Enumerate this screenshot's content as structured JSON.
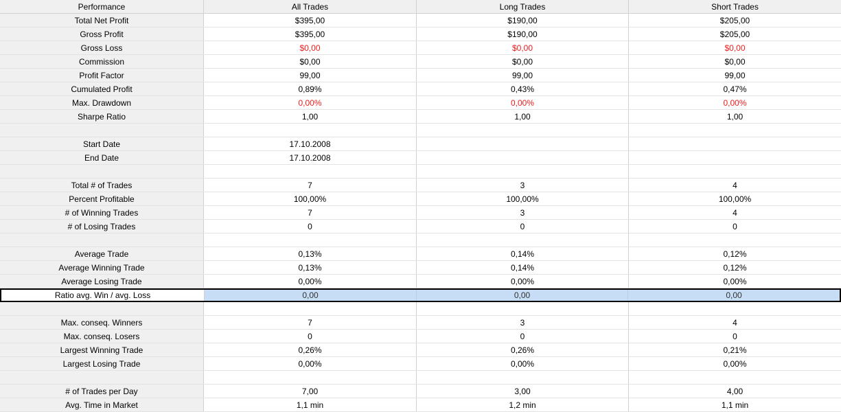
{
  "colors": {
    "negative_text": "#ee1c1c",
    "selected_row_bg": "#c6ddf5",
    "label_column_bg": "#f0f0f0"
  },
  "header": [
    "Performance",
    "All Trades",
    "Long Trades",
    "Short Trades"
  ],
  "rows": [
    {
      "label": "Total Net Profit",
      "values": [
        "$395,00",
        "$190,00",
        "$205,00"
      ]
    },
    {
      "label": "Gross Profit",
      "values": [
        "$395,00",
        "$190,00",
        "$205,00"
      ]
    },
    {
      "label": "Gross Loss",
      "values": [
        "$0,00",
        "$0,00",
        "$0,00"
      ],
      "negative": true
    },
    {
      "label": "Commission",
      "values": [
        "$0,00",
        "$0,00",
        "$0,00"
      ]
    },
    {
      "label": "Profit Factor",
      "values": [
        "99,00",
        "99,00",
        "99,00"
      ]
    },
    {
      "label": "Cumulated Profit",
      "values": [
        "0,89%",
        "0,43%",
        "0,47%"
      ]
    },
    {
      "label": "Max. Drawdown",
      "values": [
        "0,00%",
        "0,00%",
        "0,00%"
      ],
      "negative": true
    },
    {
      "label": "Sharpe Ratio",
      "values": [
        "1,00",
        "1,00",
        "1,00"
      ]
    },
    {
      "blank": true
    },
    {
      "label": "Start Date",
      "values": [
        "17.10.2008",
        "",
        ""
      ]
    },
    {
      "label": "End Date",
      "values": [
        "17.10.2008",
        "",
        ""
      ]
    },
    {
      "blank": true
    },
    {
      "label": "Total # of Trades",
      "values": [
        "7",
        "3",
        "4"
      ]
    },
    {
      "label": "Percent Profitable",
      "values": [
        "100,00%",
        "100,00%",
        "100,00%"
      ]
    },
    {
      "label": "# of Winning Trades",
      "values": [
        "7",
        "3",
        "4"
      ]
    },
    {
      "label": "# of Losing Trades",
      "values": [
        "0",
        "0",
        "0"
      ]
    },
    {
      "blank": true
    },
    {
      "label": "Average Trade",
      "values": [
        "0,13%",
        "0,14%",
        "0,12%"
      ]
    },
    {
      "label": "Average Winning Trade",
      "values": [
        "0,13%",
        "0,14%",
        "0,12%"
      ]
    },
    {
      "label": "Average Losing Trade",
      "values": [
        "0,00%",
        "0,00%",
        "0,00%"
      ]
    },
    {
      "label": "Ratio avg. Win / avg. Loss",
      "values": [
        "0,00",
        "0,00",
        "0,00"
      ],
      "selected": true
    },
    {
      "blank": true
    },
    {
      "label": "Max. conseq. Winners",
      "values": [
        "7",
        "3",
        "4"
      ]
    },
    {
      "label": "Max. conseq. Losers",
      "values": [
        "0",
        "0",
        "0"
      ]
    },
    {
      "label": "Largest Winning Trade",
      "values": [
        "0,26%",
        "0,26%",
        "0,21%"
      ]
    },
    {
      "label": "Largest Losing Trade",
      "values": [
        "0,00%",
        "0,00%",
        "0,00%"
      ]
    },
    {
      "blank": true
    },
    {
      "label": "# of Trades per Day",
      "values": [
        "7,00",
        "3,00",
        "4,00"
      ]
    },
    {
      "label": "Avg. Time in Market",
      "values": [
        "1,1 min",
        "1,2 min",
        "1,1 min"
      ]
    }
  ]
}
